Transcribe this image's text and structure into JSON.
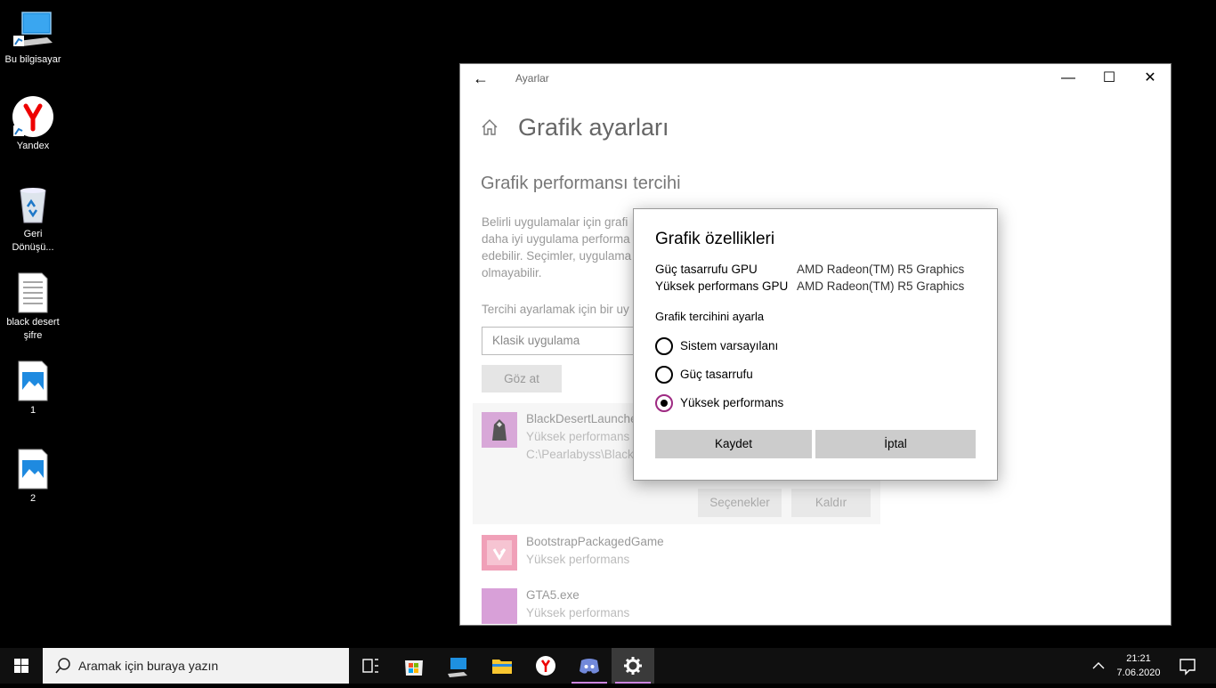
{
  "desktop": {
    "icons": [
      {
        "label": "Bu bilgisayar",
        "icon": "computer-icon"
      },
      {
        "label": "Yandex",
        "icon": "yandex-icon"
      },
      {
        "label": "Geri Dönüşü...",
        "icon": "recycle-bin-icon"
      },
      {
        "label": "black desert şifre",
        "icon": "text-file-icon"
      },
      {
        "label": "1",
        "icon": "image-file-icon"
      },
      {
        "label": "2",
        "icon": "image-file-icon"
      }
    ]
  },
  "window": {
    "title": "Ayarlar",
    "back_icon": "←",
    "minimize_icon": "—",
    "maximize_icon": "☐",
    "close_icon": "✕",
    "page_title": "Grafik ayarları",
    "section_title": "Grafik performansı tercihi",
    "description_lines": [
      "Belirli uygulamalar için grafi",
      "daha iyi uygulama performa",
      "edebilir. Seçimler, uygulama",
      "olmayabilir."
    ],
    "choose_label": "Tercihi ayarlamak için bir uy",
    "select_value": "Klasik uygulama",
    "browse_label": "Göz at",
    "apps": [
      {
        "name": "BlackDesertLaunche",
        "pref": "Yüksek performans",
        "path": "C:\\Pearlabyss\\Black"
      },
      {
        "name": "BootstrapPackagedGame",
        "pref": "Yüksek performans"
      },
      {
        "name": "GTA5.exe",
        "pref": "Yüksek performans"
      }
    ],
    "options_label": "Seçenekler",
    "remove_label": "Kaldır"
  },
  "dialog": {
    "title": "Grafik özellikleri",
    "power_saving_gpu_label": "Güç tasarrufu GPU",
    "power_saving_gpu_value": "AMD Radeon(TM) R5 Graphics",
    "high_perf_gpu_label": "Yüksek performans GPU",
    "high_perf_gpu_value": "AMD Radeon(TM) R5 Graphics",
    "set_pref_label": "Grafik tercihini ayarla",
    "options": [
      {
        "label": "Sistem varsayılanı",
        "selected": false
      },
      {
        "label": "Güç tasarrufu",
        "selected": false
      },
      {
        "label": "Yüksek performans",
        "selected": true
      }
    ],
    "save_label": "Kaydet",
    "cancel_label": "İptal"
  },
  "taskbar": {
    "search_placeholder": "Aramak için buraya yazın",
    "time": "21:21",
    "date": "7.06.2020",
    "accent": "#cc84e0"
  }
}
